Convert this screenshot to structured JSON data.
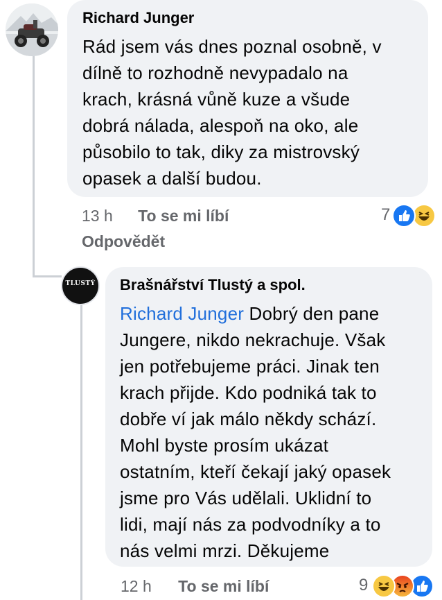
{
  "comment": {
    "author": "Richard Junger",
    "text": "Rád jsem vás dnes poznal osobně, v dílně to rozhodně nevypadalo na krach, krásná vůně kuze a všude dobrá nálada, alespoň na oko, ale působilo to tak, diky za mistrovský opasek a další budou.",
    "lines": [
      "Rád jsem vás dnes poznal osobně, v",
      "dílně to rozhodně nevypadalo na",
      "krach, krásná vůně kuze a všude",
      "dobrá nálada, alespoň na oko, ale",
      "působilo to tak, diky za mistrovský",
      "opasek a další budou."
    ],
    "time": "13 h",
    "like_label": "To se mi líbí",
    "reply_label": "Odpovědět",
    "reaction_count": "7",
    "reactions": [
      "like-reaction",
      "haha-reaction"
    ]
  },
  "reply": {
    "author": "Brašnářství Tlustý a spol.",
    "avatar_text": "TLUSTÝ",
    "mention": "Richard Junger",
    "first_line_rest": " Dobrý den pane",
    "lines": [
      "Jungere, nikdo nekrachuje. Však",
      "jen potřebujeme práci. Jinak ten",
      "krach přijde. Kdo podniká tak to",
      "dobře ví jak málo někdy schází.",
      "Mohl byste prosím ukázat",
      "ostatním, kteří čekají jaký opasek",
      "jsme pro Vás udělali. Uklidní to",
      "lidi, mají nás za podvodníky a to",
      "nás velmi mrzi. Děkujeme"
    ],
    "time": "12 h",
    "like_label": "To se mi líbí",
    "reaction_count": "9",
    "reactions": [
      "haha-reaction",
      "angry-reaction",
      "like-reaction"
    ]
  },
  "colors": {
    "bubble": "#f0f2f5",
    "mention": "#216fdb",
    "meta": "#65676b",
    "like_blue": "#1877f2",
    "haha_yellow": "#f7c843",
    "angry_orange": "#e9710f"
  }
}
